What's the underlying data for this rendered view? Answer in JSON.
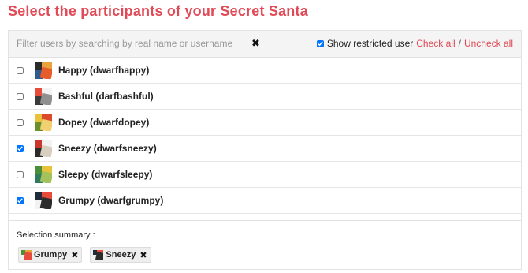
{
  "title": "Select the participants of your Secret Santa",
  "toolbar": {
    "filter_placeholder": "Filter users by searching by real name or username",
    "clear_glyph": "✖",
    "show_restricted_label": "Show restricted user",
    "show_restricted_checked": true,
    "check_all_label": "Check all",
    "separator": "/",
    "uncheck_all_label": "Uncheck all"
  },
  "users": [
    {
      "label": "Happy (dwarfhappy)",
      "checked": false,
      "avatar_colors": [
        "#2b2b2b",
        "#e8a33a",
        "#2f5b8f",
        "#e85b2b"
      ]
    },
    {
      "label": "Bashful (darfbashful)",
      "checked": false,
      "avatar_colors": [
        "#e84b3c",
        "#f2f2f2",
        "#3b3b3b",
        "#8f8f8f"
      ]
    },
    {
      "label": "Dopey (dwarfdopey)",
      "checked": false,
      "avatar_colors": [
        "#e8c23a",
        "#d94b2b",
        "#6b8f2b",
        "#f0d070"
      ]
    },
    {
      "label": "Sneezy (dwarfsneezy)",
      "checked": true,
      "avatar_colors": [
        "#c9362b",
        "#f2f2f2",
        "#2b2b2b",
        "#d9cfc0"
      ]
    },
    {
      "label": "Sleepy (dwarfsleepy)",
      "checked": false,
      "avatar_colors": [
        "#4b8f3b",
        "#e8c23a",
        "#2f7b5b",
        "#a3c25b"
      ]
    },
    {
      "label": "Grumpy (dwarfgrumpy)",
      "checked": true,
      "avatar_colors": [
        "#1f2b3b",
        "#e84b3c",
        "#f2f2f2",
        "#2b2b2b"
      ]
    }
  ],
  "summary": {
    "title": "Selection summary :",
    "chips": [
      {
        "label": "Grumpy",
        "remove_glyph": "✖",
        "avatar_colors": [
          "#4b8f3b",
          "#e8a33a",
          "#f2f2f2",
          "#e84b3c"
        ]
      },
      {
        "label": "Sneezy",
        "remove_glyph": "✖",
        "avatar_colors": [
          "#1f2b3b",
          "#e84b3c",
          "#f2f2f2",
          "#2b2b2b"
        ]
      }
    ]
  }
}
